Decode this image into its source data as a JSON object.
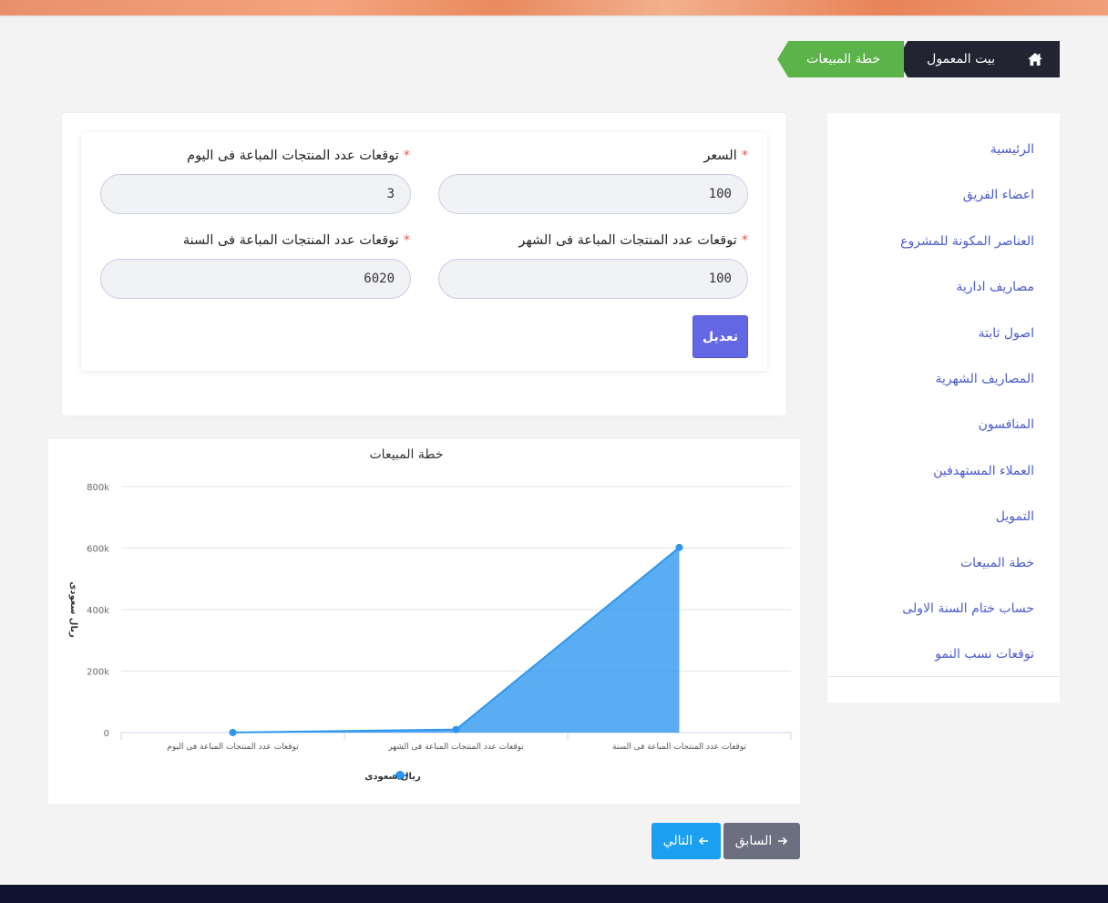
{
  "breadcrumb": {
    "home_icon": "home-icon",
    "items": [
      "بيت المعمول",
      "خطة المبيعات"
    ]
  },
  "sidebar": {
    "items": [
      {
        "label": "الرئيسية"
      },
      {
        "label": "اعضاء الفريق"
      },
      {
        "label": "العناصر المكونة للمشروع"
      },
      {
        "label": "مصاريف ادارية"
      },
      {
        "label": "اصول ثابتة"
      },
      {
        "label": "المصاريف الشهرية"
      },
      {
        "label": "المنافسون"
      },
      {
        "label": "العملاء المستهدفين"
      },
      {
        "label": "التمويل"
      },
      {
        "label": "خطة المبيعات"
      },
      {
        "label": "حساب ختام السنة الاولى"
      },
      {
        "label": "توقعات نسب النمو"
      }
    ]
  },
  "form": {
    "price": {
      "label": "السعر",
      "value": "100"
    },
    "per_day": {
      "label": "توقعات عدد المنتجات المباعة فى اليوم",
      "value": "3"
    },
    "per_month": {
      "label": "توقعات عدد المنتجات المباعة فى الشهر",
      "value": "100"
    },
    "per_year": {
      "label": "توقعات عدد المنتجات المباعة فى السنة",
      "value": "6020"
    },
    "required_mark": "*",
    "submit_label": "تعديل"
  },
  "chart_data": {
    "type": "area",
    "title": "خطة المبيعات",
    "ylabel": "ريال سعودى",
    "categories": [
      "توقعات عدد المنتجات المباعة فى اليوم",
      "توقعات عدد المنتجات المباعة فى الشهر",
      "توقعات عدد المنتجات المباعة فى السنة"
    ],
    "series": [
      {
        "name": "ريال سعودى",
        "values": [
          300,
          10000,
          602000
        ],
        "color": "#2d96ef"
      }
    ],
    "ylim": [
      0,
      800000
    ],
    "yticks": [
      "0",
      "200k",
      "400k",
      "600k",
      "800k"
    ],
    "grid": true,
    "legend": "bottom-center"
  },
  "nav": {
    "prev_label": "السابق",
    "next_label": "التالي",
    "prev_icon": "arrow-right-icon",
    "next_icon": "arrow-left-icon"
  }
}
